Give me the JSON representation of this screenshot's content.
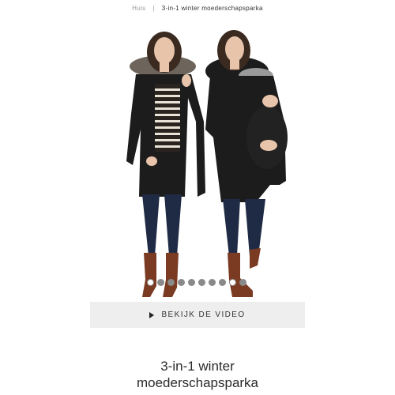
{
  "breadcrumb": {
    "home": "Huis",
    "separator": "|",
    "current": "3-in-1 winter moederschapsparka"
  },
  "gallery": {
    "image_description_icon": "product-photo",
    "dots_total": 10,
    "active_dots": [
      0,
      8
    ]
  },
  "video_button": {
    "label": "BEKIJK DE VIDEO",
    "icon": "play-icon"
  },
  "product": {
    "title_line1": "3-in-1 winter",
    "title_line2": "moederschapsparka"
  },
  "colors": {
    "button_bg": "#eeeeef",
    "coat": "#1c1c1c",
    "jeans": "#1f2a44",
    "boots": "#7a3b22"
  }
}
